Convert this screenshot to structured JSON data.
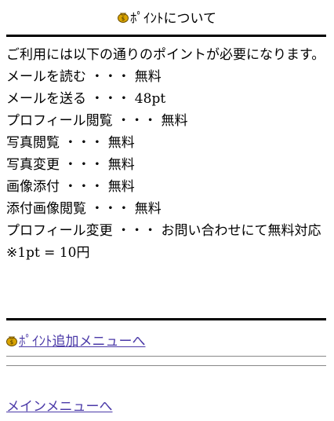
{
  "header": {
    "title": "ﾎﾟｲﾝﾄについて"
  },
  "intro": "ご利用には以下の通りのポイントが必要になります。",
  "point_list": [
    "メールを読む ・・・ 無料",
    "メールを送る ・・・ 48pt",
    "プロフィール閲覧 ・・・ 無料",
    "写真閲覧 ・・・ 無料",
    "写真変更 ・・・ 無料",
    "画像添付 ・・・ 無料",
    "添付画像閲覧 ・・・ 無料",
    "プロフィール変更 ・・・ お問い合わせにて無料対応"
  ],
  "rate_note": "※1pt = 10円",
  "links": {
    "add_points": "ﾎﾟｲﾝﾄ追加メニューへ",
    "main_menu": "メインメニューへ"
  },
  "colors": {
    "link": "#4b3aa8",
    "coin": "#d9a400"
  },
  "icons": {
    "header": "coin-bag-icon",
    "add_points": "coin-bag-icon"
  }
}
